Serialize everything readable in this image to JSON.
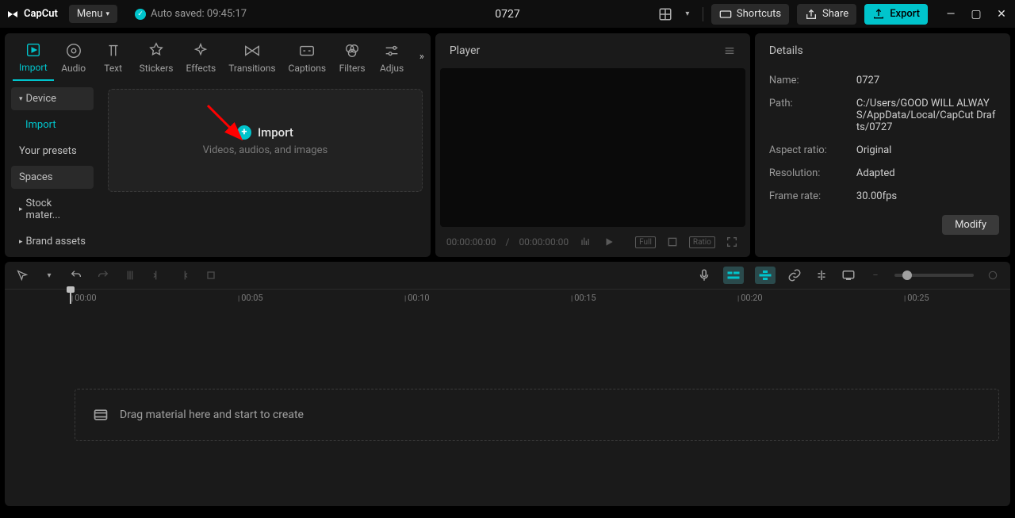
{
  "app": {
    "name": "CapCut",
    "menu_label": "Menu"
  },
  "autosave": {
    "text": "Auto saved: 09:45:17"
  },
  "project": {
    "title": "0727"
  },
  "header": {
    "shortcuts": "Shortcuts",
    "share": "Share",
    "export": "Export"
  },
  "tabs": {
    "import": "Import",
    "audio": "Audio",
    "text": "Text",
    "stickers": "Stickers",
    "effects": "Effects",
    "transitions": "Transitions",
    "captions": "Captions",
    "filters": "Filters",
    "adjust": "Adjus"
  },
  "sidebar": {
    "device": "Device",
    "import": "Import",
    "presets": "Your presets",
    "spaces": "Spaces",
    "stock": "Stock mater...",
    "brand": "Brand assets"
  },
  "dropzone": {
    "title": "Import",
    "subtitle": "Videos, audios, and images"
  },
  "player": {
    "title": "Player",
    "time_current": "00:00:00:00",
    "time_sep": " / ",
    "time_total": "00:00:00:00",
    "full": "Full",
    "ratio": "Ratio"
  },
  "details": {
    "title": "Details",
    "name_lbl": "Name:",
    "name_val": "0727",
    "path_lbl": "Path:",
    "path_val": "C:/Users/GOOD WILL ALWAYS/AppData/Local/CapCut Drafts/0727",
    "aspect_lbl": "Aspect ratio:",
    "aspect_val": "Original",
    "res_lbl": "Resolution:",
    "res_val": "Adapted",
    "fps_lbl": "Frame rate:",
    "fps_val": "30.00fps",
    "modify": "Modify"
  },
  "ruler": {
    "t0": "00:00",
    "t1": "00:05",
    "t2": "00:10",
    "t3": "00:15",
    "t4": "00:20",
    "t5": "00:25"
  },
  "timeline": {
    "drop_hint": "Drag material here and start to create"
  }
}
